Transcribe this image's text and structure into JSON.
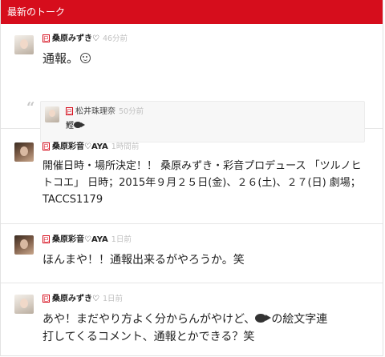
{
  "header": {
    "title": "最新のトーク"
  },
  "posts": [
    {
      "badge": "巳",
      "user": "桑原みずき♡",
      "time": "46分前",
      "text": "通報。",
      "emoji": "smile-icon",
      "quote": {
        "badge": "巳",
        "user": "松井珠理奈",
        "time": "50分前",
        "text": "鰹",
        "emoji": "fish-icon"
      }
    },
    {
      "badge": "巳",
      "user": "桑原彩音♡AYA",
      "time": "1時間前",
      "line1": "開催日時・場所決定！！ 桑原みずき・彩音プロデュース 「ツルノヒ",
      "line2": "トコエ」 日時；2015年９月２５日(金)、２６(土)、２７(日) 劇場；",
      "line3": "TACCS1179"
    },
    {
      "badge": "巳",
      "user": "桑原彩音♡AYA",
      "time": "1日前",
      "text": "ほんまや！！通報出来るがやろうか。笑"
    },
    {
      "badge": "巳",
      "user": "桑原みずき♡",
      "time": "1日前",
      "line1a": "あや！まだやり方よく分からんがやけど、",
      "line1b": "の絵文字連",
      "line2": "打してくるコメント、通報とかできる？笑",
      "emoji": "fish-icon"
    }
  ]
}
